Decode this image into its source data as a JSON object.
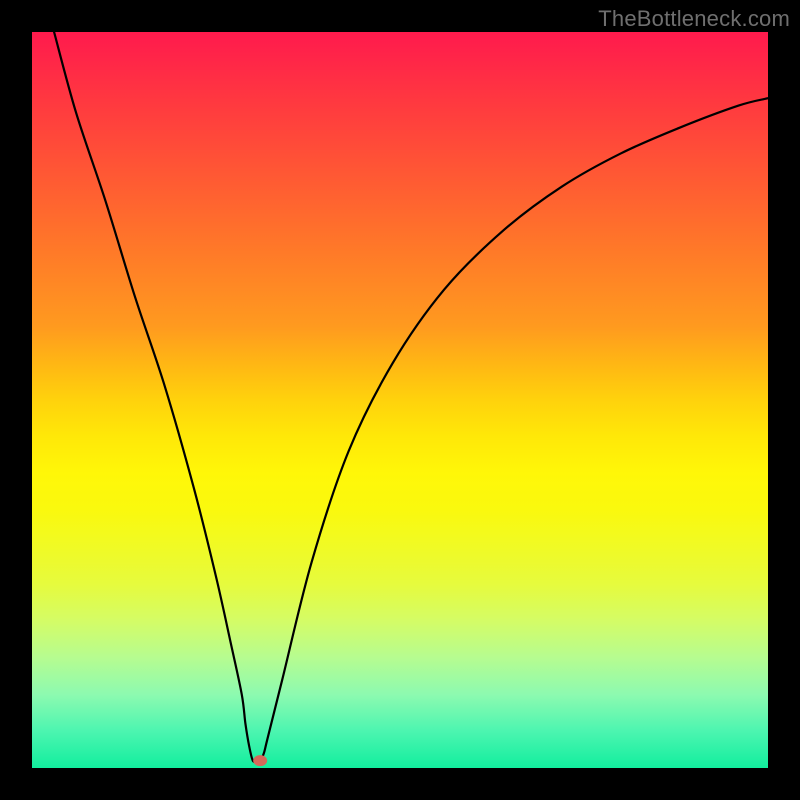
{
  "watermark": {
    "text": "TheBottleneck.com"
  },
  "chart_data": {
    "type": "line",
    "title": "",
    "xlabel": "",
    "ylabel": "",
    "xlim": [
      0,
      100
    ],
    "ylim": [
      0,
      100
    ],
    "grid": false,
    "legend": false,
    "series": [
      {
        "name": "curve",
        "x": [
          3,
          6,
          10,
          14,
          18,
          22,
          25,
          27,
          28.5,
          29,
          29.5,
          30,
          30.5,
          31,
          31.5,
          32,
          34,
          38,
          43,
          49,
          56,
          64,
          72,
          80,
          88,
          96,
          100
        ],
        "values": [
          100,
          89,
          77,
          64,
          52,
          38,
          26,
          17,
          10,
          6,
          3,
          1,
          1,
          1,
          2,
          4,
          12,
          28,
          43,
          55,
          65,
          73,
          79,
          83.5,
          87,
          90,
          91
        ]
      }
    ],
    "marker": {
      "x": 31,
      "y": 1,
      "color": "#d46a5a"
    },
    "gradient_stops": [
      {
        "pos": 0,
        "color": "#ff1a4d"
      },
      {
        "pos": 50,
        "color": "#ffd20c"
      },
      {
        "pos": 100,
        "color": "#12ee9e"
      }
    ],
    "annotations": []
  }
}
